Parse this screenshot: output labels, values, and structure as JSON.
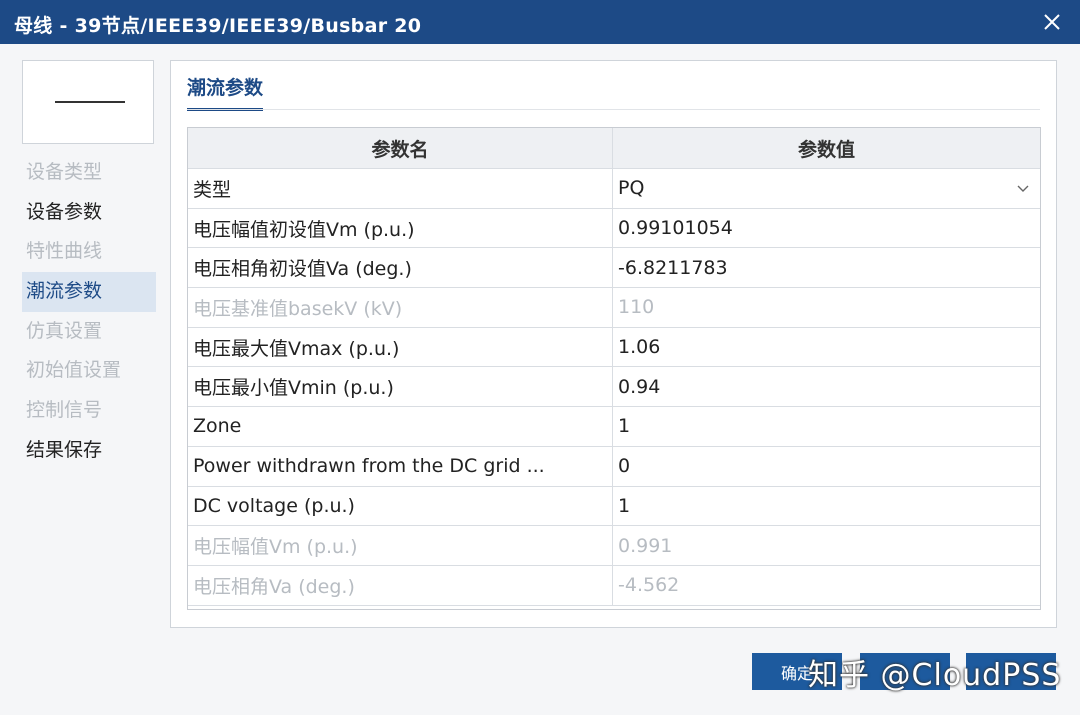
{
  "window": {
    "title": "母线 - 39节点/IEEE39/IEEE39/Busbar 20",
    "close_glyph": "✕"
  },
  "sidebar": {
    "items": [
      {
        "label": "设备类型",
        "state": "disabled"
      },
      {
        "label": "设备参数",
        "state": "normal"
      },
      {
        "label": "特性曲线",
        "state": "disabled"
      },
      {
        "label": "潮流参数",
        "state": "selected"
      },
      {
        "label": "仿真设置",
        "state": "disabled"
      },
      {
        "label": "初始值设置",
        "state": "disabled"
      },
      {
        "label": "控制信号",
        "state": "disabled"
      },
      {
        "label": "结果保存",
        "state": "normal"
      }
    ]
  },
  "panel": {
    "tab_label": "潮流参数",
    "table": {
      "headers": {
        "name": "参数名",
        "value": "参数值"
      },
      "rows": [
        {
          "name": "类型",
          "value": "PQ",
          "dropdown": true,
          "disabled": false
        },
        {
          "name": "电压幅值初设值Vm (p.u.)",
          "value": "0.99101054",
          "disabled": false
        },
        {
          "name": "电压相角初设值Va (deg.)",
          "value": "-6.8211783",
          "disabled": false
        },
        {
          "name": "电压基准值basekV (kV)",
          "value": "110",
          "disabled": true
        },
        {
          "name": "电压最大值Vmax (p.u.)",
          "value": "1.06",
          "disabled": false
        },
        {
          "name": "电压最小值Vmin (p.u.)",
          "value": "0.94",
          "disabled": false
        },
        {
          "name": "Zone",
          "value": "1",
          "disabled": false
        },
        {
          "name": "Power withdrawn from the DC grid ...",
          "value": "0",
          "disabled": false
        },
        {
          "name": "DC voltage (p.u.)",
          "value": "1",
          "disabled": false
        },
        {
          "name": "电压幅值Vm (p.u.)",
          "value": "0.991",
          "disabled": true
        },
        {
          "name": "电压相角Va (deg.)",
          "value": "-4.562",
          "disabled": true
        }
      ]
    }
  },
  "footer": {
    "ok_label": "确定",
    "cancel_label": "",
    "apply_label": "",
    "watermark": "知乎 @CloudPSS"
  },
  "colors": {
    "titlebar": "#1d4a86",
    "accent": "#1d4a86",
    "button": "#1d5a9e",
    "disabled_text": "#b7bcc2"
  }
}
